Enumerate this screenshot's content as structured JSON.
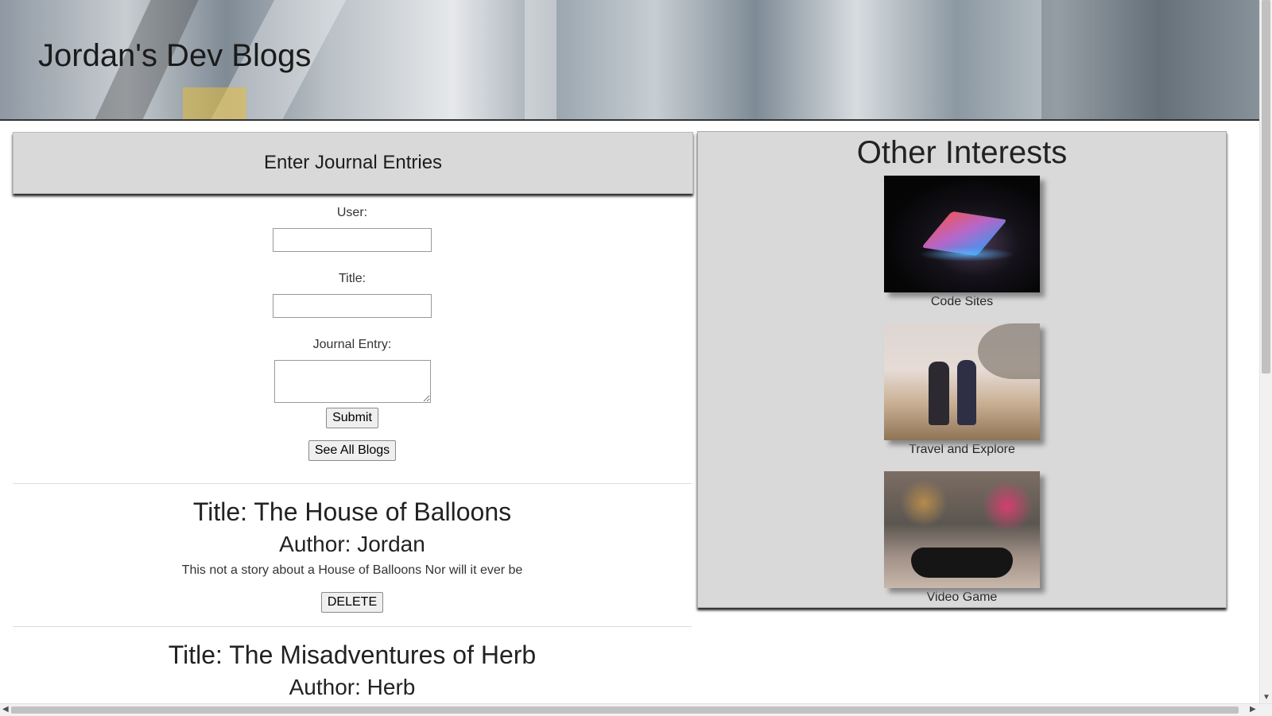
{
  "header": {
    "title": "Jordan's Dev Blogs"
  },
  "journal": {
    "heading": "Enter Journal Entries",
    "user_label": "User:",
    "user_value": "",
    "title_label": "Title:",
    "title_value": "",
    "entry_label": "Journal Entry:",
    "entry_value": "",
    "submit_label": "Submit",
    "see_all_label": "See All Blogs"
  },
  "posts": [
    {
      "title": "Title: The House of Balloons",
      "author": "Author: Jordan",
      "body": "This not a story about a House of Balloons Nor will it ever be",
      "delete_label": "DELETE"
    },
    {
      "title": "Title: The Misadventures of Herb",
      "author": "Author: Herb"
    }
  ],
  "interests": {
    "heading": "Other Interests",
    "items": [
      {
        "caption": "Code Sites",
        "image": "laptop-photo"
      },
      {
        "caption": "Travel and Explore",
        "image": "beach-walkers-photo"
      },
      {
        "caption": "Video Game",
        "image": "game-controller-photo"
      }
    ]
  },
  "scrollbar": {
    "up": "▲",
    "down": "▼",
    "left": "◀",
    "right": "▶"
  }
}
